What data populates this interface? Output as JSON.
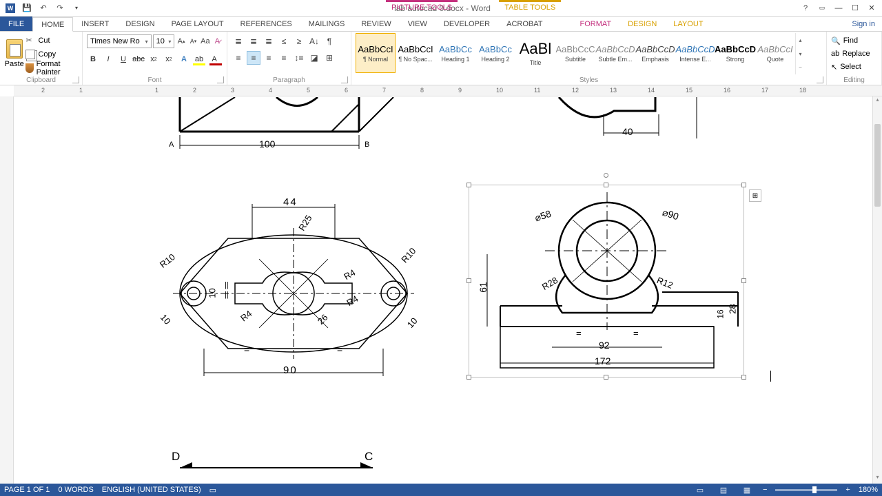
{
  "app": {
    "title": "lab autocad 0.docx - Word"
  },
  "ctx": {
    "picture": "PICTURE TOOLS",
    "table": "TABLE TOOLS"
  },
  "tabs": {
    "file": "FILE",
    "home": "HOME",
    "insert": "INSERT",
    "design": "DESIGN",
    "pagelayout": "PAGE LAYOUT",
    "references": "REFERENCES",
    "mailings": "MAILINGS",
    "review": "REVIEW",
    "view": "VIEW",
    "developer": "DEVELOPER",
    "acrobat": "ACROBAT",
    "format": "FORMAT",
    "design2": "DESIGN",
    "layout": "LAYOUT",
    "signin": "Sign in"
  },
  "clipboard": {
    "label": "Clipboard",
    "paste": "Paste",
    "cut": "Cut",
    "copy": "Copy",
    "painter": "Format Painter"
  },
  "font": {
    "label": "Font",
    "family": "Times New Ro",
    "size": "10"
  },
  "paragraph": {
    "label": "Paragraph"
  },
  "styles": {
    "label": "Styles",
    "items": [
      {
        "prev": "AaBbCcI",
        "name": "¶ Normal",
        "sel": true,
        "color": "#000"
      },
      {
        "prev": "AaBbCcI",
        "name": "¶ No Spac...",
        "color": "#000"
      },
      {
        "prev": "AaBbCc",
        "name": "Heading 1",
        "color": "#2e74b5"
      },
      {
        "prev": "AaBbCc",
        "name": "Heading 2",
        "color": "#2e74b5"
      },
      {
        "prev": "AaBl",
        "name": "Title",
        "big": true,
        "color": "#000"
      },
      {
        "prev": "AaBbCcC",
        "name": "Subtitle",
        "color": "#888"
      },
      {
        "prev": "AaBbCcD",
        "name": "Subtle Em...",
        "color": "#888",
        "italic": true
      },
      {
        "prev": "AaBbCcD",
        "name": "Emphasis",
        "color": "#444",
        "italic": true
      },
      {
        "prev": "AaBbCcD",
        "name": "Intense E...",
        "color": "#2e74b5",
        "italic": true
      },
      {
        "prev": "AaBbCcD",
        "name": "Strong",
        "color": "#000",
        "bold": true
      },
      {
        "prev": "AaBbCcI",
        "name": "Quote",
        "color": "#888",
        "italic": true
      }
    ]
  },
  "editing": {
    "label": "Editing",
    "find": "Find",
    "replace": "Replace",
    "select": "Select"
  },
  "ruler": {
    "marks": [
      "2",
      "1",
      "",
      "1",
      "2",
      "3",
      "4",
      "5",
      "6",
      "7",
      "8",
      "9",
      "10",
      "11",
      "12",
      "13",
      "14",
      "15",
      "16",
      "17",
      "18"
    ]
  },
  "status": {
    "page": "PAGE 1 OF 1",
    "words": "0 WORDS",
    "lang": "ENGLISH (UNITED STATES)",
    "zoom": "180%"
  },
  "fig_top_left": {
    "A": "A",
    "B": "B",
    "dim": "100"
  },
  "fig_top_right": {
    "dim": "40"
  },
  "fig_mid_left": {
    "top": "44",
    "bottom": "90",
    "R25": "R25",
    "R10a": "R10",
    "R10b": "R10",
    "R4a": "R4",
    "R4b": "R4",
    "R4c": "R4",
    "d10a": "10",
    "d10b": "10",
    "d26": "26",
    "ten": "10",
    "eqa": "=",
    "eqb": "=",
    "tick": "||"
  },
  "fig_mid_right": {
    "d58": "⌀58",
    "d90": "⌀90",
    "R28": "R28",
    "R12": "R12",
    "d61": "61",
    "d28": "28",
    "d16": "16",
    "d92": "92",
    "d172": "172",
    "eqa": "=",
    "eqb": "="
  },
  "fig_bot": {
    "D": "D",
    "C": "C"
  }
}
